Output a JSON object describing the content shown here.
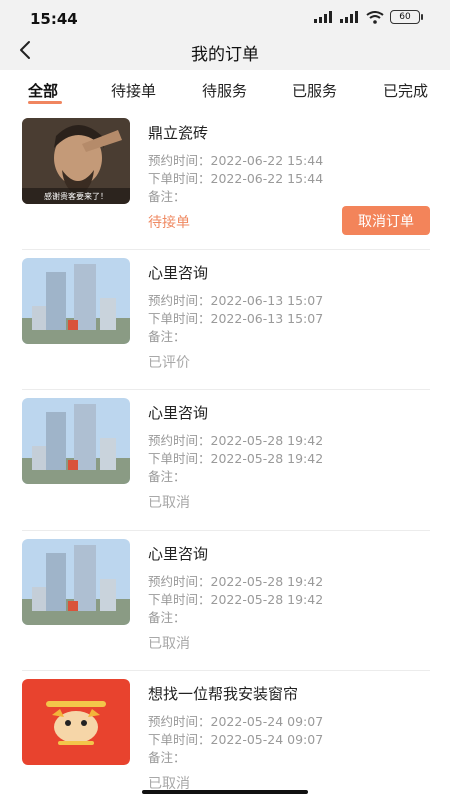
{
  "status_bar": {
    "time": "15:44",
    "battery": "60"
  },
  "header": {
    "title": "我的订单"
  },
  "tabs": [
    {
      "label": "全部"
    },
    {
      "label": "待接单"
    },
    {
      "label": "待服务"
    },
    {
      "label": "已服务"
    },
    {
      "label": "已完成"
    }
  ],
  "labels": {
    "booking": "预约时间：",
    "order": "下单时间：",
    "note": "备注："
  },
  "colors": {
    "accent": "#f3845a",
    "status_orange": "#ef8a63",
    "status_gray": "#a8a8a8"
  },
  "orders": [
    {
      "title": "鼎立瓷砖",
      "booking_time": "2022-06-22 15:44",
      "order_time": "2022-06-22 15:44",
      "note": "",
      "status": "待接单",
      "action": "取消订单",
      "thumb_caption": "感谢贵客要来了！"
    },
    {
      "title": "心里咨询",
      "booking_time": "2022-06-13 15:07",
      "order_time": "2022-06-13 15:07",
      "note": "",
      "status": "已评价"
    },
    {
      "title": "心里咨询",
      "booking_time": "2022-05-28 19:42",
      "order_time": "2022-05-28 19:42",
      "note": "",
      "status": "已取消"
    },
    {
      "title": "心里咨询",
      "booking_time": "2022-05-28 19:42",
      "order_time": "2022-05-28 19:42",
      "note": "",
      "status": "已取消"
    },
    {
      "title": "想找一位帮我安装窗帘",
      "booking_time": "2022-05-24 09:07",
      "order_time": "2022-05-24 09:07",
      "note": "",
      "status": "已取消"
    }
  ]
}
